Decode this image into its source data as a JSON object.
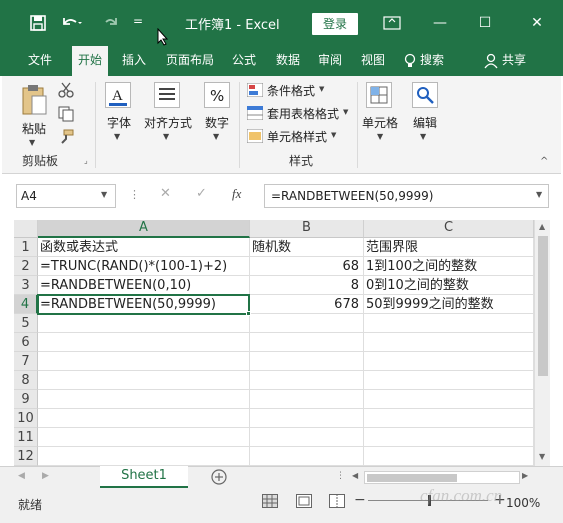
{
  "titlebar": {
    "title": "工作簿1 - Excel",
    "signin": "登录",
    "qat_more": "=",
    "min": "—",
    "restore": "☐",
    "close": "✕"
  },
  "tabs": {
    "items": [
      "文件",
      "开始",
      "插入",
      "页面布局",
      "公式",
      "数据",
      "审阅",
      "视图"
    ],
    "tell_me": "搜索",
    "share": "共享"
  },
  "ribbon": {
    "paste": "粘贴",
    "clipboard": "剪贴板",
    "font": "字体",
    "alignment": "对齐方式",
    "number": "数字",
    "conditional": "条件格式",
    "table_format": "套用表格格式",
    "cell_style": "单元格样式",
    "styles": "样式",
    "cells": "单元格",
    "editing": "编辑"
  },
  "formula_bar": {
    "name_box": "A4",
    "formula": "=RANDBETWEEN(50,9999)"
  },
  "grid": {
    "columns": [
      "A",
      "B",
      "C"
    ],
    "rows": [
      "1",
      "2",
      "3",
      "4",
      "5",
      "6",
      "7",
      "8",
      "9",
      "10",
      "11",
      "12"
    ],
    "cells": [
      [
        "函数或表达式",
        "随机数",
        "范围界限"
      ],
      [
        "=TRUNC(RAND()*(100-1)+2)",
        "68",
        "1到100之间的整数"
      ],
      [
        "=RANDBETWEEN(0,10)",
        "8",
        "0到10之间的整数"
      ],
      [
        "=RANDBETWEEN(50,9999)",
        "678",
        "50到9999之间的整数"
      ]
    ]
  },
  "sheets": {
    "active": "Sheet1"
  },
  "status": {
    "ready": "就绪",
    "zoom": "100%"
  },
  "watermark": "cfan.com.cn",
  "colors": {
    "accent": "#217346"
  }
}
